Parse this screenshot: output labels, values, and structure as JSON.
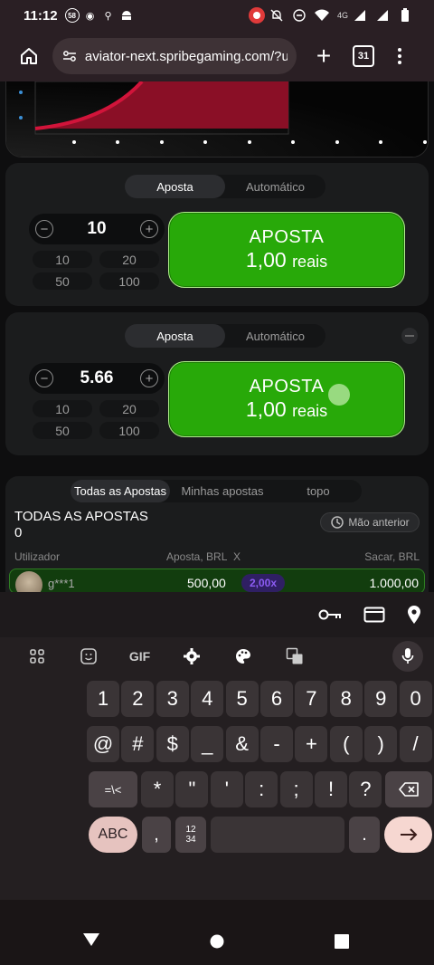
{
  "status_bar": {
    "time": "11:12",
    "notif_badge": "58",
    "network": "4G"
  },
  "browser": {
    "url": "aviator-next.spribegaming.com/?u",
    "tab_count": "31"
  },
  "bet_panel_1": {
    "tabs": [
      "Aposta",
      "Automático"
    ],
    "active_tab": "Aposta",
    "stake": "10",
    "quick_amounts": [
      "10",
      "20",
      "50",
      "100"
    ],
    "button_line1": "APOSTA",
    "button_amount": "1,00",
    "button_currency": "reais"
  },
  "bet_panel_2": {
    "tabs": [
      "Aposta",
      "Automático"
    ],
    "active_tab": "Aposta",
    "stake": "5.66",
    "quick_amounts": [
      "10",
      "20",
      "50",
      "100"
    ],
    "button_line1": "APOSTA",
    "button_amount": "1,00",
    "button_currency": "reais"
  },
  "bets_list": {
    "tabs": [
      "Todas as Apostas",
      "Minhas apostas",
      "topo"
    ],
    "active_tab": "Todas as Apostas",
    "title": "TODAS AS APOSTAS",
    "count": "0",
    "previous_round": "Mão anterior",
    "headers": {
      "user": "Utilizador",
      "bet": "Aposta, BRL",
      "mult": "X",
      "cashout": "Sacar, BRL"
    },
    "rows": [
      {
        "user": "g***1",
        "bet": "500,00",
        "mult": "2,00x",
        "cashout": "1.000,00"
      }
    ]
  },
  "keyboard": {
    "row_numbers": [
      "1",
      "2",
      "3",
      "4",
      "5",
      "6",
      "7",
      "8",
      "9",
      "0"
    ],
    "row_symbols": [
      "@",
      "#",
      "$",
      "_",
      "&",
      "-",
      "+",
      "(",
      ")",
      "/"
    ],
    "row_more": [
      "*",
      "\"",
      "'",
      ":",
      ";",
      "!",
      "?"
    ],
    "toggle_label": "=\\<",
    "gif_label": "GIF",
    "abc_label": "ABC",
    "comma": ",",
    "numpad_label": "12\n34",
    "period": "."
  },
  "colors": {
    "bet_green": "#28a909",
    "multiplier_purple": "#8c5cf3",
    "graph_red": "#c0102f"
  }
}
